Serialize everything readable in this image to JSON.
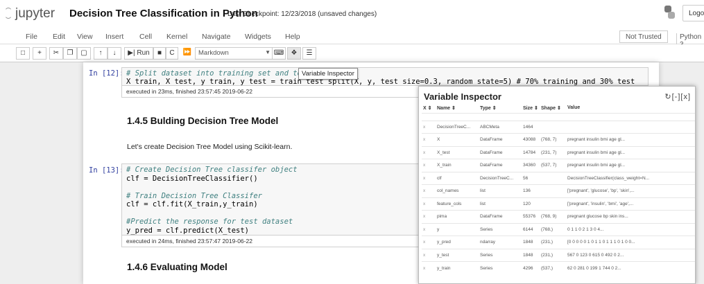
{
  "header": {
    "logo": "jupyter",
    "title": "Decision Tree Classification in Python",
    "checkpoint": "Last Checkpoint: 12/23/2018  (unsaved changes)",
    "logout": "Logo"
  },
  "menu": [
    "File",
    "Edit",
    "View",
    "Insert",
    "Cell",
    "Kernel",
    "Navigate",
    "Widgets",
    "Help"
  ],
  "trust": "Not Trusted",
  "kernel": "Python 3",
  "toolbar": {
    "run_label": "Run",
    "cell_type": "Markdown"
  },
  "tooltip": "Variable Inspector",
  "cells": {
    "c12": {
      "prompt": "In [12]:",
      "comment": "# Split dataset into training set and test set",
      "code": "X_train, X_test, y_train, y_test = train_test_split(X, y, test_size=0.3, random_state=5) # 70% training and 30% test",
      "exec": "executed in 23ms, finished 23:57:45 2019-06-22"
    },
    "h145": "1.4.5  Bulding Decision Tree Model",
    "p145": "Let's create Decision Tree Model using Scikit-learn.",
    "c13": {
      "prompt": "In [13]:",
      "l1": "# Create Decision Tree classifer object",
      "l2": "clf = DecisionTreeClassifier()",
      "l3": "# Train Decision Tree Classifer",
      "l4": "clf = clf.fit(X_train,y_train)",
      "l5": "#Predict the response for test dataset",
      "l6": "y_pred = clf.predict(X_test)",
      "exec": "executed in 24ms, finished 23:57:47 2019-06-22"
    },
    "h146": "1.4.6  Evaluating Model"
  },
  "inspector": {
    "title": "Variable Inspector",
    "controls": "↻[-][x]",
    "headers": [
      "X",
      "Name",
      "Type",
      "Size",
      "Shape",
      "Value"
    ],
    "rows": [
      [
        "x",
        "DecisionTreeC...",
        "ABCMeta",
        "1464",
        "",
        ""
      ],
      [
        "x",
        "X",
        "DataFrame",
        "43088",
        "(768, 7)",
        "pregnant insulin bmi age gl..."
      ],
      [
        "x",
        "X_test",
        "DataFrame",
        "14784",
        "(231, 7)",
        "pregnant insulin bmi age gl..."
      ],
      [
        "x",
        "X_train",
        "DataFrame",
        "34360",
        "(537, 7)",
        "pregnant insulin bmi age gl..."
      ],
      [
        "x",
        "clf",
        "DecisionTreeC...",
        "56",
        "",
        "DecisionTreeClassifier(class_weight=N..."
      ],
      [
        "x",
        "col_names",
        "list",
        "136",
        "",
        "['pregnant', 'glucose', 'bp', 'skin',..."
      ],
      [
        "x",
        "feature_cols",
        "list",
        "120",
        "",
        "['pregnant', 'insulin', 'bmi', 'age',..."
      ],
      [
        "x",
        "pima",
        "DataFrame",
        "55376",
        "(768, 9)",
        "pregnant glucose bp skin ins..."
      ],
      [
        "x",
        "y",
        "Series",
        "6144",
        "(768,)",
        "0 1 1 0 2 1 3 0 4..."
      ],
      [
        "x",
        "y_pred",
        "ndarray",
        "1848",
        "(231,)",
        "[0 0 0 0 0 1 0 1 1 0 1 1 1 0 1 0 0..."
      ],
      [
        "x",
        "y_test",
        "Series",
        "1848",
        "(231,)",
        "567 0 123 0 615 0 492 0 2..."
      ],
      [
        "x",
        "y_train",
        "Series",
        "4296",
        "(537,)",
        "62 0 281 0 199 1 744 0 2..."
      ]
    ]
  }
}
